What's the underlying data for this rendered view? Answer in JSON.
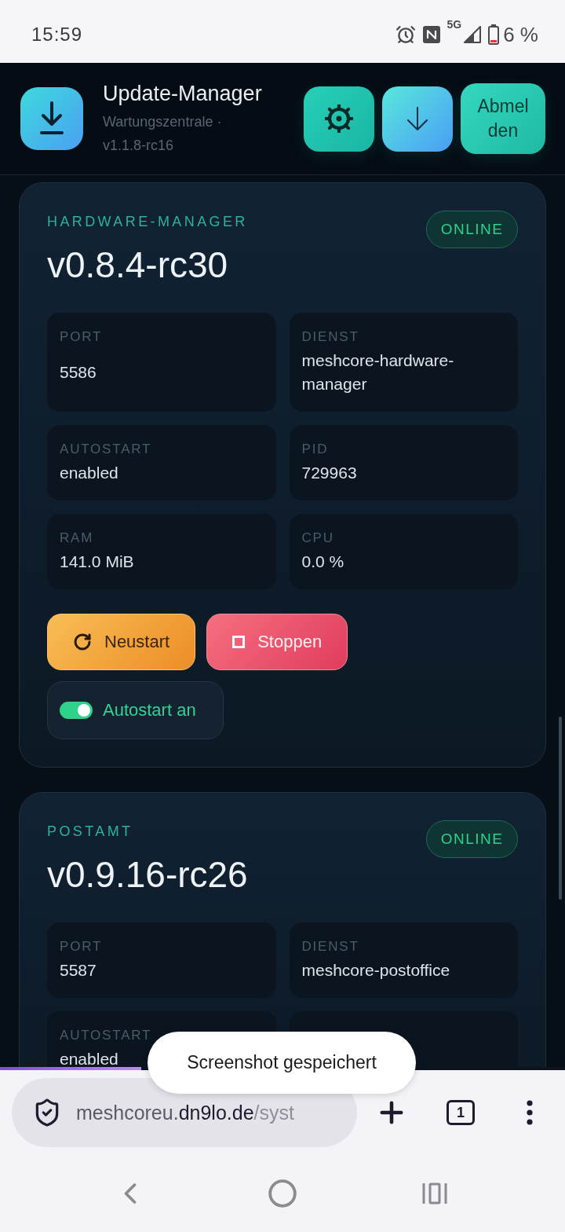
{
  "status_bar": {
    "time": "15:59",
    "network": "5G",
    "battery": "6 %"
  },
  "header": {
    "title": "Update-Manager",
    "subtitle": "Wartungszentrale · v1.1.8-rc16",
    "actions": [
      {
        "kind": "settings"
      },
      {
        "kind": "download"
      },
      {
        "kind": "logout",
        "label": "Abmelden"
      }
    ]
  },
  "services": [
    {
      "name": "HARDWARE-MANAGER",
      "version": "v0.8.4-rc30",
      "status": {
        "kind": "online",
        "label": "ONLINE"
      },
      "fields": [
        {
          "label": "PORT",
          "value": "5586"
        },
        {
          "label": "DIENST",
          "value": "meshcore-hardware-manager"
        },
        {
          "label": "AUTOSTART",
          "value": "enabled"
        },
        {
          "label": "PID",
          "value": "729963"
        },
        {
          "label": "RAM",
          "value": "141.0 MiB"
        },
        {
          "label": "CPU",
          "value": "0.0 %"
        }
      ],
      "actions": [
        {
          "kind": "restart",
          "label": "Neustart"
        },
        {
          "kind": "stop",
          "label": "Stoppen"
        }
      ],
      "autostart": {
        "label": "Autostart an",
        "on": true
      }
    },
    {
      "name": "POSTAMT",
      "version": "v0.9.16-rc26",
      "status": {
        "kind": "online",
        "label": "ONLINE"
      },
      "fields": [
        {
          "label": "PORT",
          "value": "5587"
        },
        {
          "label": "DIENST",
          "value": "meshcore-postoffice"
        },
        {
          "label": "AUTOSTART",
          "value": "enabled"
        }
      ]
    }
  ],
  "toast": {
    "text": "Screenshot gespeichert"
  },
  "page_load": {
    "level": 0.25
  },
  "browser": {
    "url": {
      "prefix": "meshcoreu.",
      "domain": "dn9lo.de",
      "path": "/syst"
    },
    "tab_count": "1"
  }
}
